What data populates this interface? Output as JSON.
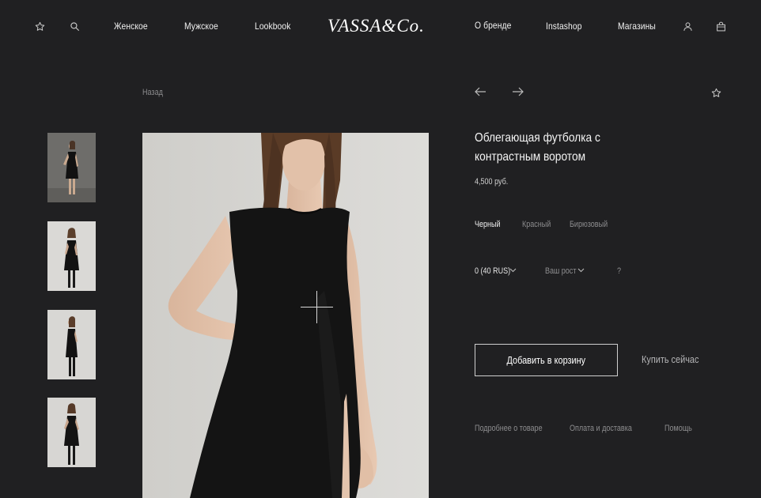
{
  "header": {
    "logo": "VASSA&Co.",
    "nav_left": [
      "Женское",
      "Мужское",
      "Lookbook"
    ],
    "nav_right": [
      "О бренде",
      "Instashop",
      "Магазины"
    ]
  },
  "breadcrumb": {
    "back_label": "Назад"
  },
  "product": {
    "title": "Облегающая футболка с контрастным воротом",
    "price": "4,500 руб.",
    "colors": [
      "Черный",
      "Красный",
      "Бирюзовый"
    ],
    "selected_color": "Черный",
    "size_value": "0 (40 RUS)",
    "height_placeholder": "Ваш рост",
    "help_mark": "?",
    "add_to_cart": "Добавить в корзину",
    "buy_now": "Купить сейчас",
    "info_tabs": [
      "Подробнее о товаре",
      "Оплата и доставка",
      "Помощь"
    ]
  },
  "gallery": {
    "thumbnail_count": 4,
    "zoom_icon": "plus-crosshair"
  },
  "icons": [
    "star-icon",
    "search-icon",
    "user-icon",
    "bag-icon",
    "arrow-left-icon",
    "arrow-right-icon",
    "chevron-down-icon"
  ],
  "colors": {
    "background": "#202022",
    "text": "#f2f2f2",
    "muted": "#8d8d8f",
    "photo_bg": "#d6d5d2",
    "dress": "#141414"
  }
}
